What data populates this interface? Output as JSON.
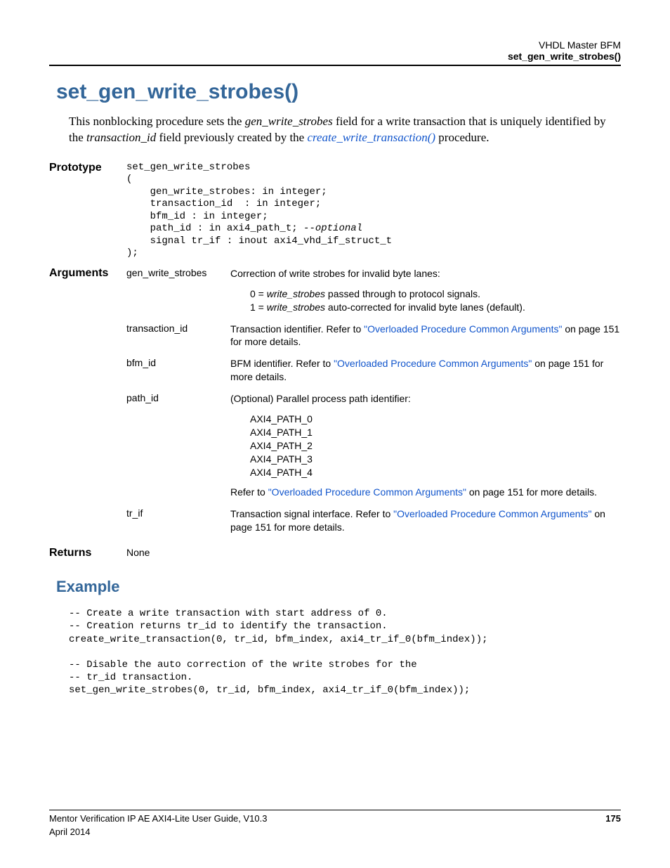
{
  "header": {
    "line1": "VHDL Master BFM",
    "line2": "set_gen_write_strobes()"
  },
  "title": "set_gen_write_strobes()",
  "intro": {
    "t1": "This nonblocking procedure sets the ",
    "i1": "gen_write_strobes",
    "t2": " field for a write transaction that is uniquely identified by the ",
    "i2": "transaction_id",
    "t3": " field previously created by the ",
    "link": "create_write_transaction()",
    "t4": " procedure."
  },
  "labels": {
    "prototype": "Prototype",
    "arguments": "Arguments",
    "returns": "Returns"
  },
  "prototype": {
    "l1": "set_gen_write_strobes",
    "l2": "(",
    "l3": "    gen_write_strobes: in integer;",
    "l4": "    transaction_id  : in integer;",
    "l5": "    bfm_id : in integer;",
    "l6a": "    path_id : in axi4_path_t; ",
    "l6b": "--optional",
    "l7": "    signal tr_if : inout axi4_vhd_if_struct_t",
    "l8": ");"
  },
  "args": {
    "a1": {
      "name": "gen_write_strobes",
      "d1": "Correction of write strobes for invalid byte lanes:",
      "d2a": "0 = ",
      "d2i": "write_strobes",
      "d2b": " passed through to protocol signals.",
      "d3a": "1 = ",
      "d3i": "write_strobes",
      "d3b": " auto-corrected for invalid byte lanes (default)."
    },
    "a2": {
      "name": "transaction_id",
      "d1": "Transaction identifier. Refer to ",
      "link1": "\"Overloaded Procedure Common Arguments\"",
      "d2": " on page 151 for more details."
    },
    "a3": {
      "name": "bfm_id",
      "d1": "BFM identifier. Refer to ",
      "link1": "\"Overloaded Procedure Common Arguments\"",
      "d2": " on page 151 for more details."
    },
    "a4": {
      "name": "path_id",
      "d1": "(Optional) Parallel process path identifier:",
      "p1": "AXI4_PATH_0",
      "p2": "AXI4_PATH_1",
      "p3": "AXI4_PATH_2",
      "p4": "AXI4_PATH_3",
      "p5": "AXI4_PATH_4",
      "d2": "Refer to ",
      "link1": "\"Overloaded Procedure Common Arguments\"",
      "d3": " on page 151 for more details."
    },
    "a5": {
      "name": "tr_if",
      "d1": "Transaction signal interface. Refer to ",
      "link1": "\"Overloaded Procedure Common Arguments\"",
      "d2": " on page 151 for more details."
    }
  },
  "returns": "None",
  "example_heading": "Example",
  "example": {
    "l1": "-- Create a write transaction with start address of 0.",
    "l2": "-- Creation returns tr_id to identify the transaction.",
    "l3": "create_write_transaction(0, tr_id, bfm_index, axi4_tr_if_0(bfm_index));",
    "l4": "",
    "l5": "-- Disable the auto correction of the write strobes for the",
    "l6": "-- tr_id transaction.",
    "l7": "set_gen_write_strobes(0, tr_id, bfm_index, axi4_tr_if_0(bfm_index));"
  },
  "footer": {
    "left1": "Mentor Verification IP AE AXI4-Lite User Guide, V10.3",
    "left2": "April 2014",
    "page": "175"
  }
}
